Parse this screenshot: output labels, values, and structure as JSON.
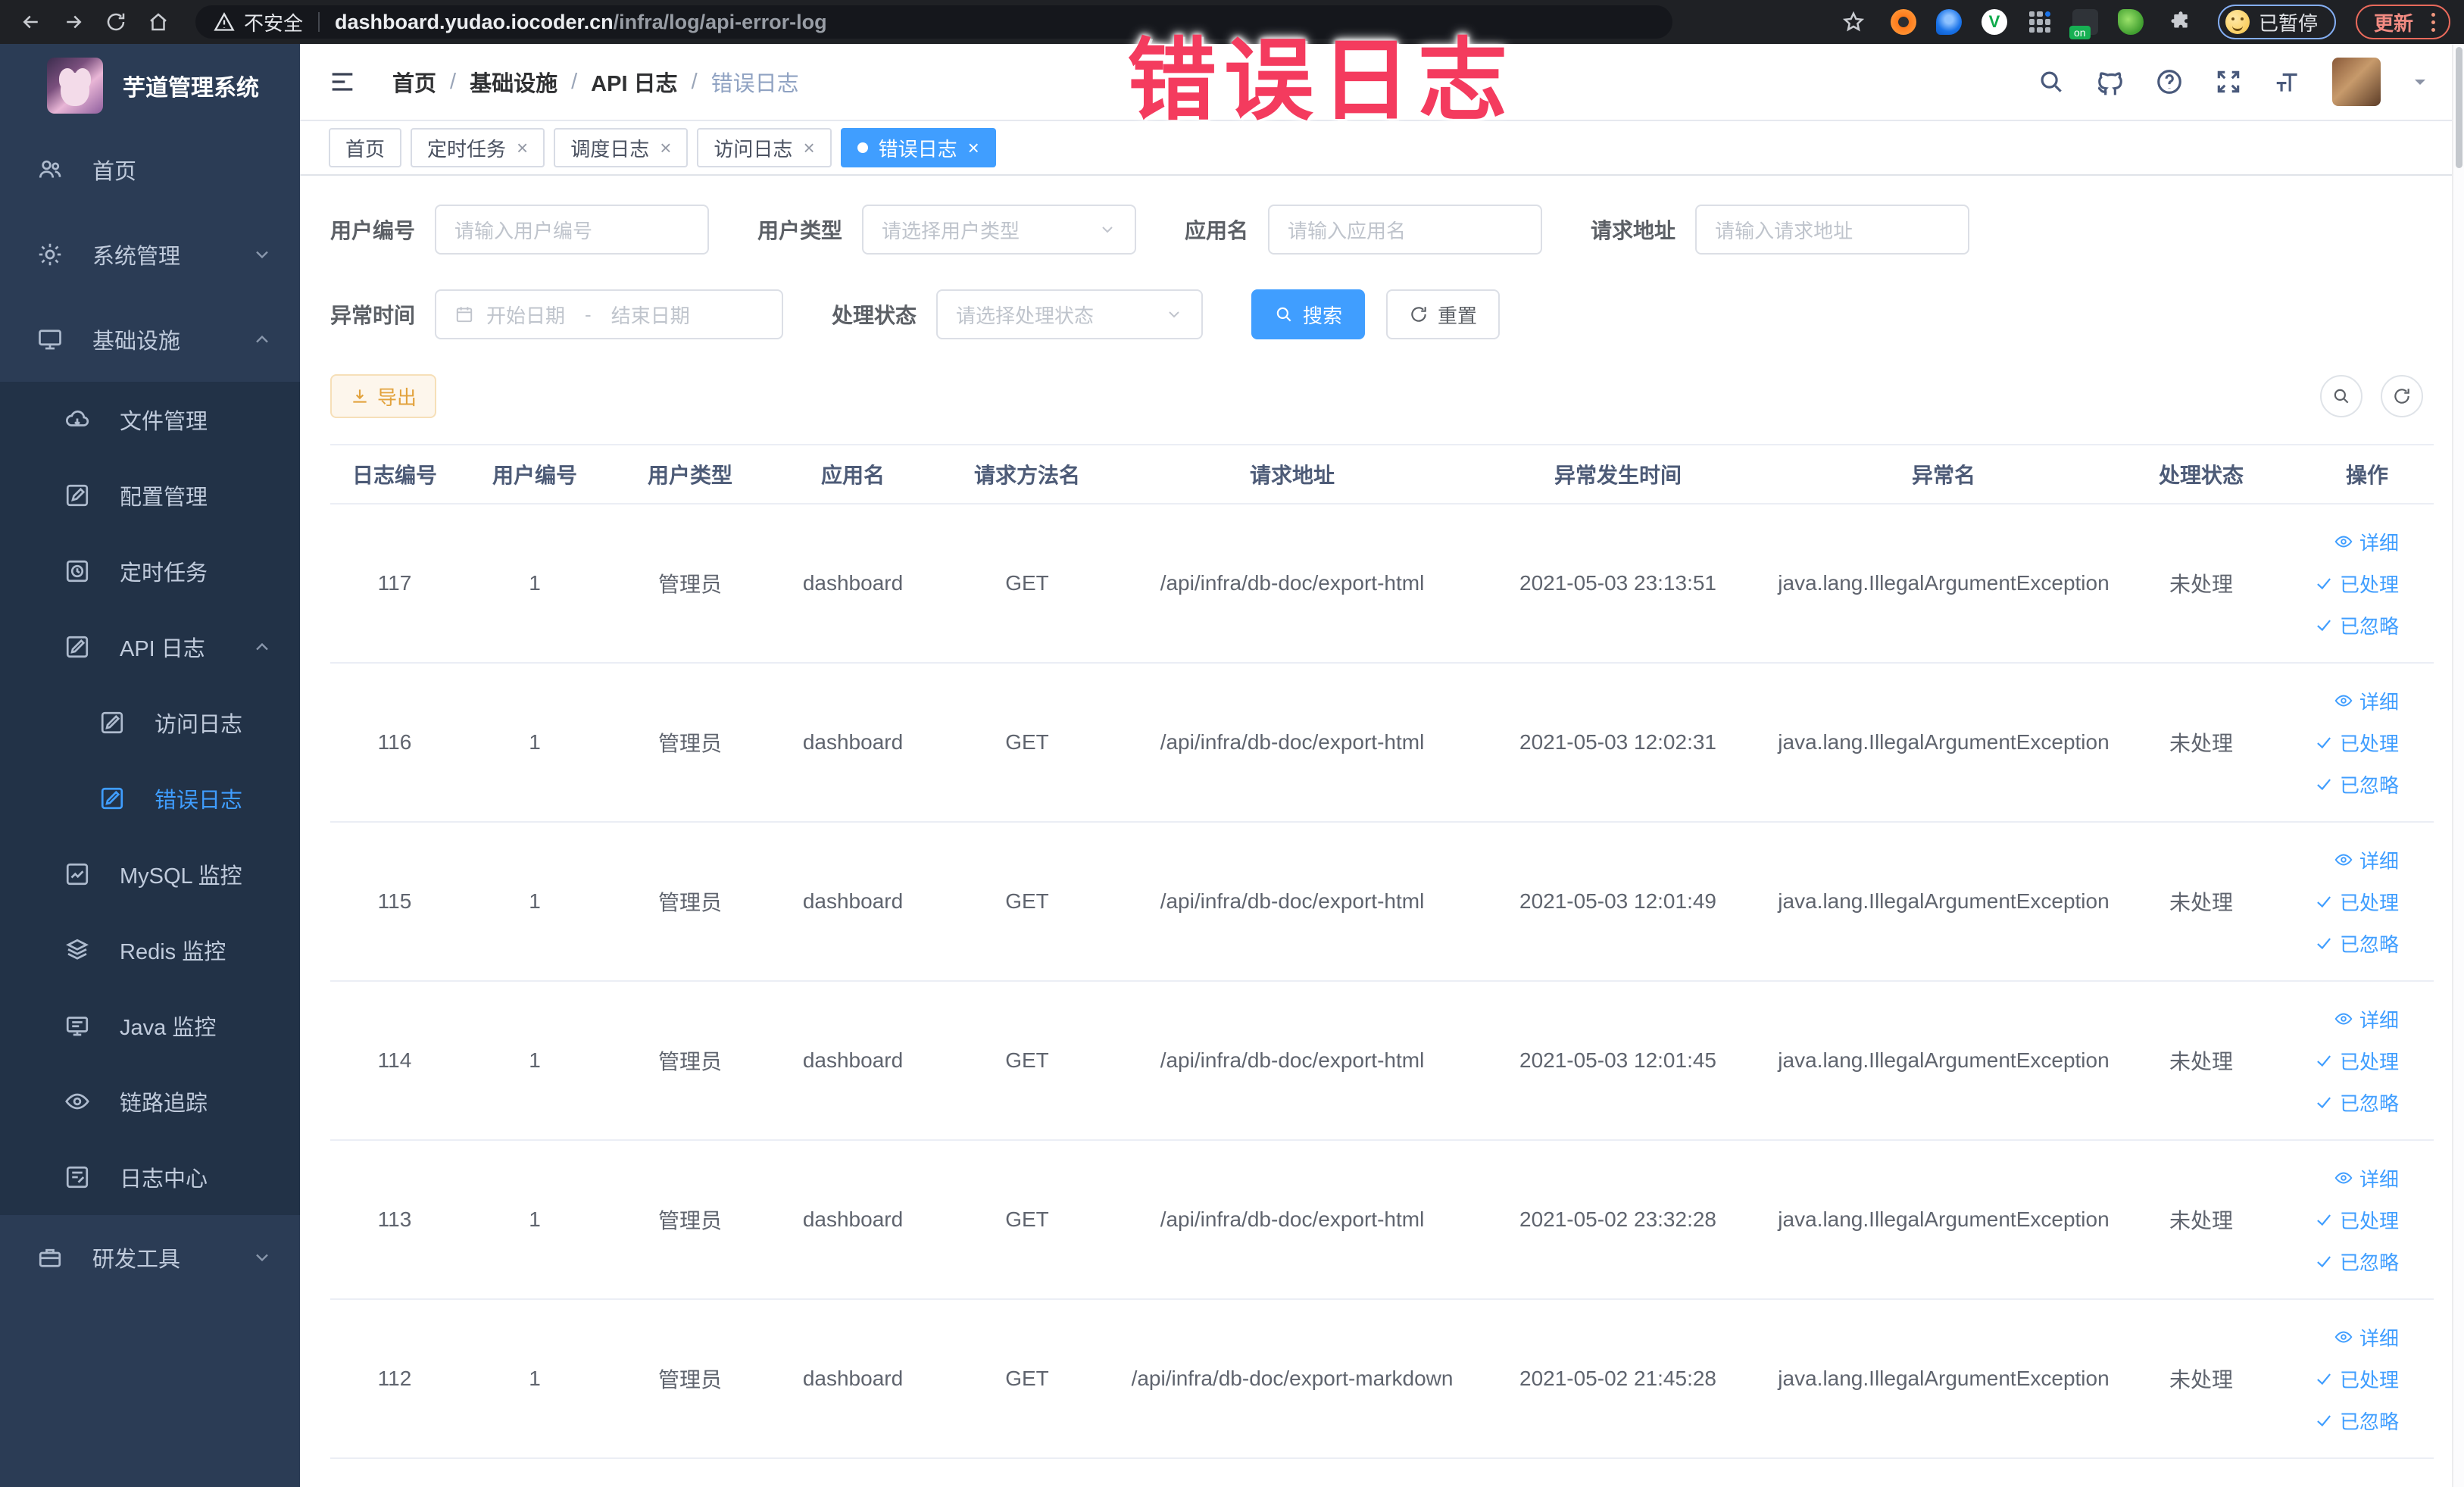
{
  "watermark": {
    "text": "错误日志",
    "color": "#f43b5e"
  },
  "browser": {
    "security_label": "不安全",
    "url_host": "dashboard.yudao.iocoder.cn",
    "url_path": "/infra/log/api-error-log",
    "paused_label": "已暂停",
    "update_label": "更新"
  },
  "sidebar": {
    "title": "芋道管理系统",
    "home": "首页",
    "system": "系统管理",
    "infra": "基础设施",
    "file": "文件管理",
    "config": "配置管理",
    "job": "定时任务",
    "api_log": "API 日志",
    "access_log": "访问日志",
    "error_log": "错误日志",
    "mysql": "MySQL 监控",
    "redis": "Redis 监控",
    "java": "Java 监控",
    "trace": "链路追踪",
    "log_center": "日志中心",
    "dev_tools": "研发工具"
  },
  "header": {
    "breadcrumb": [
      "首页",
      "基础设施",
      "API 日志",
      "错误日志"
    ]
  },
  "tabs": [
    {
      "label": "首页"
    },
    {
      "label": "定时任务"
    },
    {
      "label": "调度日志"
    },
    {
      "label": "访问日志"
    },
    {
      "label": "错误日志"
    }
  ],
  "filters": {
    "user_id_label": "用户编号",
    "user_id_placeholder": "请输入用户编号",
    "user_type_label": "用户类型",
    "user_type_placeholder": "请选择用户类型",
    "app_name_label": "应用名",
    "app_name_placeholder": "请输入应用名",
    "request_url_label": "请求地址",
    "request_url_placeholder": "请输入请求地址",
    "time_label": "异常时间",
    "time_start_placeholder": "开始日期",
    "time_separator": "-",
    "time_end_placeholder": "结束日期",
    "status_label": "处理状态",
    "status_placeholder": "请选择处理状态",
    "search_label": "搜索",
    "reset_label": "重置"
  },
  "toolbar": {
    "export_label": "导出"
  },
  "table": {
    "columns": [
      "日志编号",
      "用户编号",
      "用户类型",
      "应用名",
      "请求方法名",
      "请求地址",
      "异常发生时间",
      "异常名",
      "处理状态",
      "操作"
    ],
    "actions": {
      "detail": "详细",
      "processed": "已处理",
      "ignored": "已忽略"
    },
    "rows": [
      {
        "id": "117",
        "user_id": "1",
        "user_type": "管理员",
        "app": "dashboard",
        "method": "GET",
        "url": "/api/infra/db-doc/export-html",
        "time": "2021-05-03 23:13:51",
        "exception": "java.lang.IllegalArgumentException",
        "status": "未处理"
      },
      {
        "id": "116",
        "user_id": "1",
        "user_type": "管理员",
        "app": "dashboard",
        "method": "GET",
        "url": "/api/infra/db-doc/export-html",
        "time": "2021-05-03 12:02:31",
        "exception": "java.lang.IllegalArgumentException",
        "status": "未处理"
      },
      {
        "id": "115",
        "user_id": "1",
        "user_type": "管理员",
        "app": "dashboard",
        "method": "GET",
        "url": "/api/infra/db-doc/export-html",
        "time": "2021-05-03 12:01:49",
        "exception": "java.lang.IllegalArgumentException",
        "status": "未处理"
      },
      {
        "id": "114",
        "user_id": "1",
        "user_type": "管理员",
        "app": "dashboard",
        "method": "GET",
        "url": "/api/infra/db-doc/export-html",
        "time": "2021-05-03 12:01:45",
        "exception": "java.lang.IllegalArgumentException",
        "status": "未处理"
      },
      {
        "id": "113",
        "user_id": "1",
        "user_type": "管理员",
        "app": "dashboard",
        "method": "GET",
        "url": "/api/infra/db-doc/export-html",
        "time": "2021-05-02 23:32:28",
        "exception": "java.lang.IllegalArgumentException",
        "status": "未处理"
      },
      {
        "id": "112",
        "user_id": "1",
        "user_type": "管理员",
        "app": "dashboard",
        "method": "GET",
        "url": "/api/infra/db-doc/export-markdown",
        "time": "2021-05-02 21:45:28",
        "exception": "java.lang.IllegalArgumentException",
        "status": "未处理"
      }
    ]
  }
}
